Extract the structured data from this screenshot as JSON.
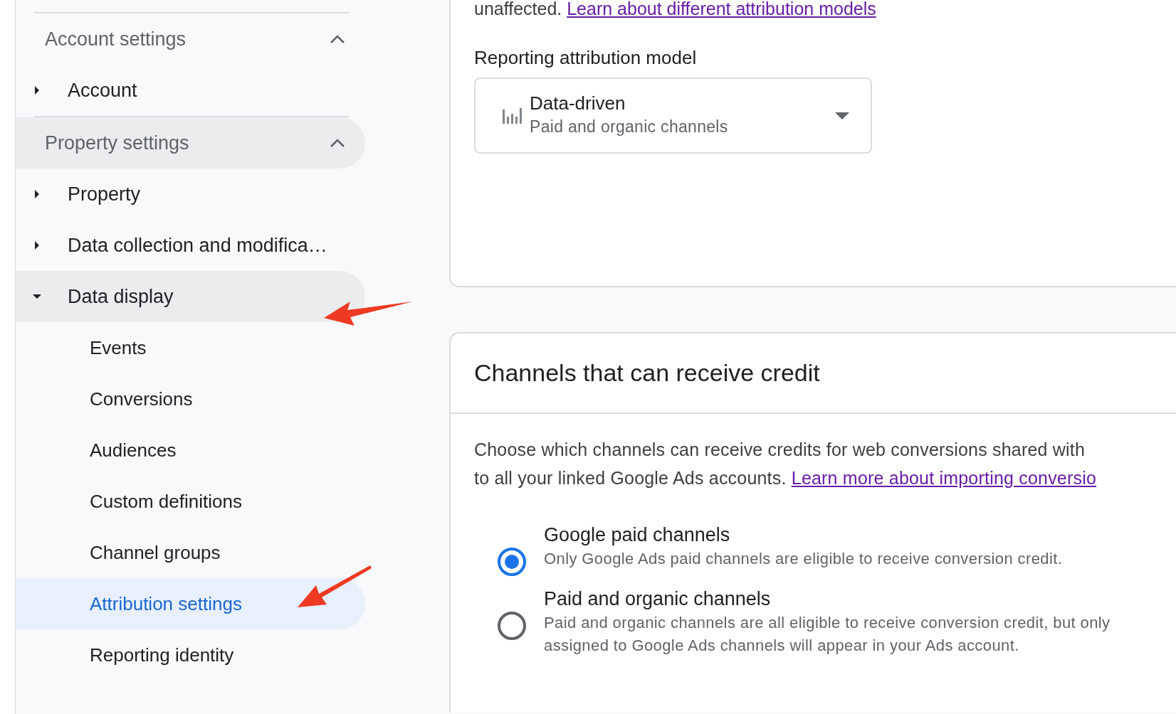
{
  "sidebar": {
    "sections": [
      {
        "title": "Account settings",
        "expanded": true,
        "highlighted": false,
        "items": [
          {
            "label": "Account",
            "expanded": false,
            "highlighted": false
          }
        ]
      },
      {
        "title": "Property settings",
        "expanded": true,
        "highlighted": true,
        "items": [
          {
            "label": "Property",
            "expanded": false,
            "highlighted": false
          },
          {
            "label": "Data collection and modifica…",
            "expanded": false,
            "highlighted": false
          },
          {
            "label": "Data display",
            "expanded": true,
            "highlighted": true,
            "children": [
              {
                "label": "Events",
                "selected": false
              },
              {
                "label": "Conversions",
                "selected": false
              },
              {
                "label": "Audiences",
                "selected": false
              },
              {
                "label": "Custom definitions",
                "selected": false
              },
              {
                "label": "Channel groups",
                "selected": false
              },
              {
                "label": "Attribution settings",
                "selected": true
              },
              {
                "label": "Reporting identity",
                "selected": false
              }
            ]
          }
        ]
      }
    ]
  },
  "attribution_card": {
    "intro_text": "unaffected.",
    "intro_link": "Learn about different attribution models",
    "field_label": "Reporting attribution model",
    "dropdown": {
      "value": "Data-driven",
      "subtitle": "Paid and organic channels"
    }
  },
  "channels_card": {
    "title": "Channels that can receive credit",
    "description_lines": [
      "Choose which channels can receive credits for web conversions shared with",
      "to all your linked Google Ads accounts."
    ],
    "description_link": "Learn more about importing conversio",
    "options": [
      {
        "label": "Google paid channels",
        "selected": true,
        "description_lines": [
          "Only Google Ads paid channels are eligible to receive conversion credit."
        ]
      },
      {
        "label": "Paid and organic channels",
        "selected": false,
        "description_lines": [
          "Paid and organic channels are all eligible to receive conversion credit, but only",
          "assigned to Google Ads channels will appear in your Ads account."
        ]
      }
    ]
  }
}
